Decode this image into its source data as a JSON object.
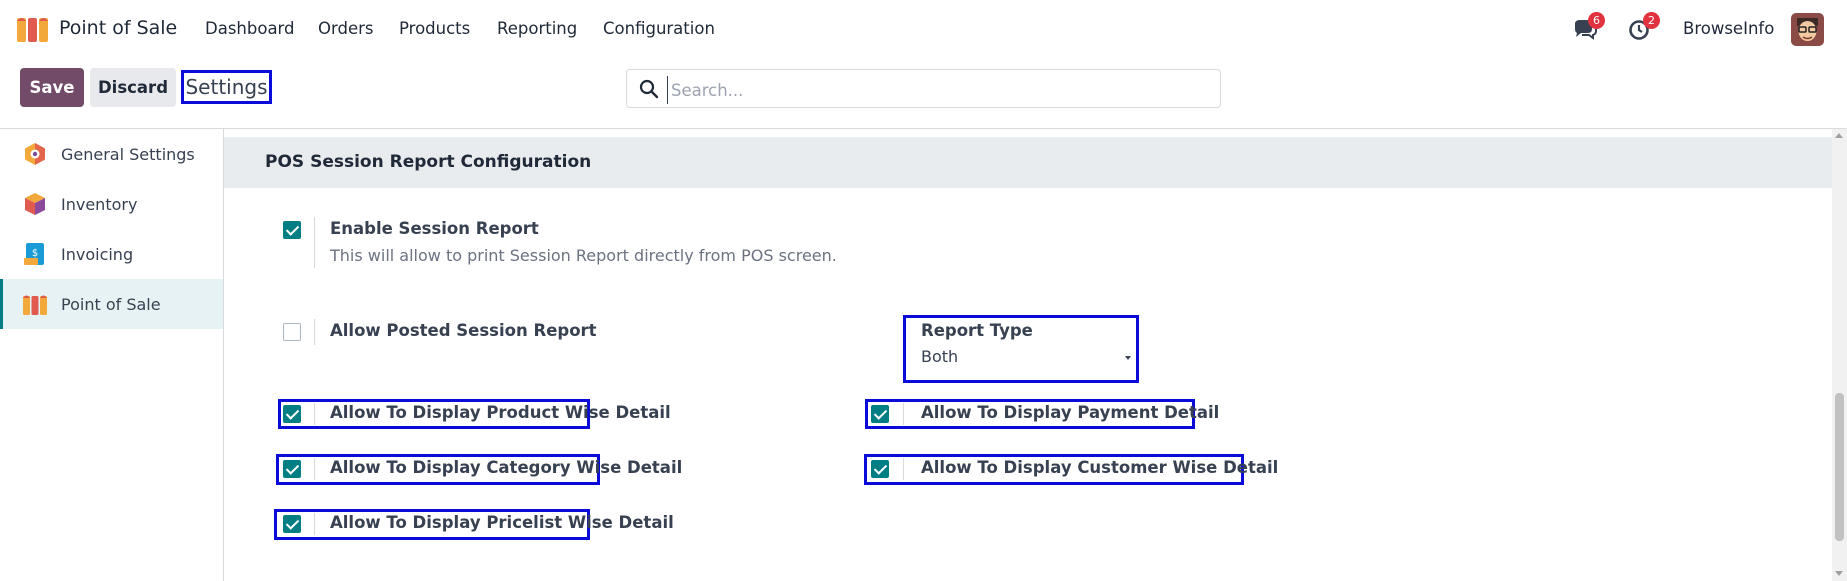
{
  "navbar": {
    "app_name": "Point of Sale",
    "menu": [
      "Dashboard",
      "Orders",
      "Products",
      "Reporting",
      "Configuration"
    ],
    "messages_count": "6",
    "activities_count": "2",
    "user_name": "BrowseInfo"
  },
  "control": {
    "save_label": "Save",
    "discard_label": "Discard",
    "title": "Settings",
    "search_placeholder": "Search..."
  },
  "sidebar": {
    "items": [
      {
        "label": "General Settings",
        "icon": "general-settings-icon"
      },
      {
        "label": "Inventory",
        "icon": "inventory-icon"
      },
      {
        "label": "Invoicing",
        "icon": "invoicing-icon"
      },
      {
        "label": "Point of Sale",
        "icon": "point-of-sale-icon",
        "active": true
      }
    ]
  },
  "section": {
    "title": "POS Session Report Configuration",
    "enable_session_report": {
      "label": "Enable Session Report",
      "description": "This will allow to print Session Report directly from POS screen.",
      "checked": true
    },
    "allow_posted": {
      "label": "Allow Posted Session Report",
      "checked": false
    },
    "report_type": {
      "label": "Report Type",
      "value": "Both"
    },
    "product_wise": {
      "label": "Allow To Display Product Wise Detail",
      "checked": true
    },
    "payment_detail": {
      "label": "Allow To Display Payment Detail",
      "checked": true
    },
    "category_wise": {
      "label": "Allow To Display Category Wise Detail",
      "checked": true
    },
    "customer_wise": {
      "label": "Allow To Display Customer Wise Detail",
      "checked": true
    },
    "pricelist_wise": {
      "label": "Allow To Display Pricelist Wise Detail",
      "checked": true
    }
  },
  "colors": {
    "primary": "#714b67",
    "checkbox_accent": "#017e84",
    "highlight_box": "#0b0bd9",
    "badge": "#e0333f"
  }
}
